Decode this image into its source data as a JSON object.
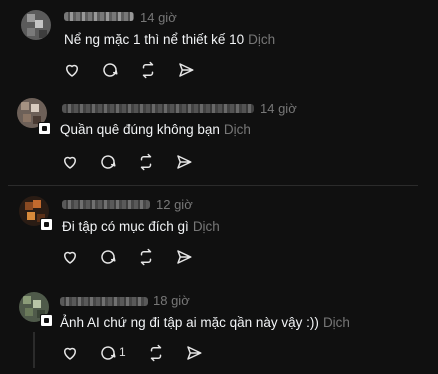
{
  "comments": [
    {
      "username": "",
      "time": "14 giờ",
      "text": "Nể ng mặc 1 thì nể thiết kế 10",
      "translate": "Dịch",
      "reply_count": ""
    },
    {
      "username": "",
      "time": "14 giờ",
      "text": "Quần quê đúng không bạn",
      "translate": "Dịch",
      "reply_count": ""
    },
    {
      "username": "",
      "time": "12 giờ",
      "text": "Đi tập có mục đích gì",
      "translate": "Dịch",
      "reply_count": ""
    },
    {
      "username": "",
      "time": "18 giờ",
      "text": "Ảnh AI chứ ng đi tập ai mặc qần này vậy :))",
      "translate": "Dịch",
      "reply_count": "1"
    }
  ],
  "icons": [
    "heart-icon",
    "comment-icon",
    "repost-icon",
    "share-icon"
  ],
  "colors": {
    "background": "#101010",
    "text": "#f3f5f7",
    "muted": "#777777"
  }
}
